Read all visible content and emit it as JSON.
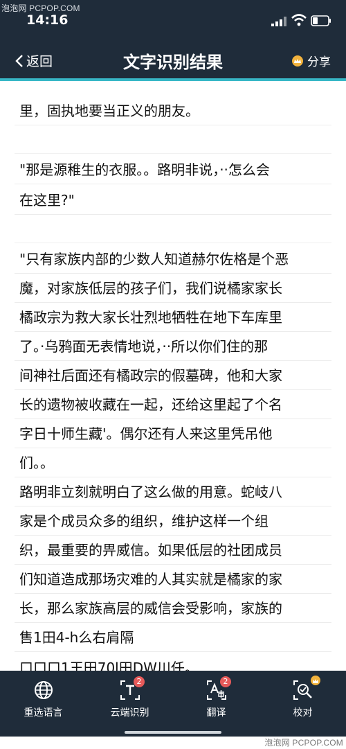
{
  "watermark_top": "泡泡网 PCPOP.COM",
  "status_bar": {
    "time": "14:16"
  },
  "nav": {
    "back_label": "返回",
    "title": "文字识别结果",
    "share_label": "分享"
  },
  "content": {
    "lines": [
      "里，固执地要当正义的朋友。",
      "",
      "\"那是源稚生的衣服。。路明非说，··怎么会",
      "在这里?\"",
      "",
      "\"只有家族内部的少数人知道赫尔佐格是个恶",
      "魔，对家族低层的孩子们，我们说橘家家长",
      "橘政宗为救大家长壮烈地牺牲在地下车库里",
      "了。·乌鸦面无表情地说，··所以你们住的那",
      "间神社后面还有橘政宗的假墓碑，他和大家",
      "长的遗物被收藏在一起，还给这里起了个名",
      "字日十师生藏'。偶尔还有人来这里凭吊他",
      "们。。",
      "路明非立刻就明白了这么做的用意。蛇岐八",
      "家是个成员众多的组织，维护这样一个组",
      "织，最重要的畀威信。如果低层的社团成员",
      "们知道造成那场灾难的人其实就是橘家的家",
      "长，那么家族高层的威信会受影响，家族的",
      "售1田4-h么右肩隔",
      "口口口1王田70l田DW川任。"
    ]
  },
  "tabbar": {
    "items": [
      {
        "label": "重选语言",
        "icon": "globe-icon",
        "badge": ""
      },
      {
        "label": "云端识别",
        "icon": "cloud-text-icon",
        "badge": "2"
      },
      {
        "label": "翻译",
        "icon": "translate-icon",
        "badge": "2"
      },
      {
        "label": "校对",
        "icon": "proofread-icon",
        "badge": ""
      }
    ]
  },
  "watermark_bottom": "泡泡网 PCPOP.COM",
  "colors": {
    "header": "#1f2c3a",
    "accent": "#38b7c6",
    "badge": "#e65a5a",
    "crown": "#f2b33d"
  }
}
